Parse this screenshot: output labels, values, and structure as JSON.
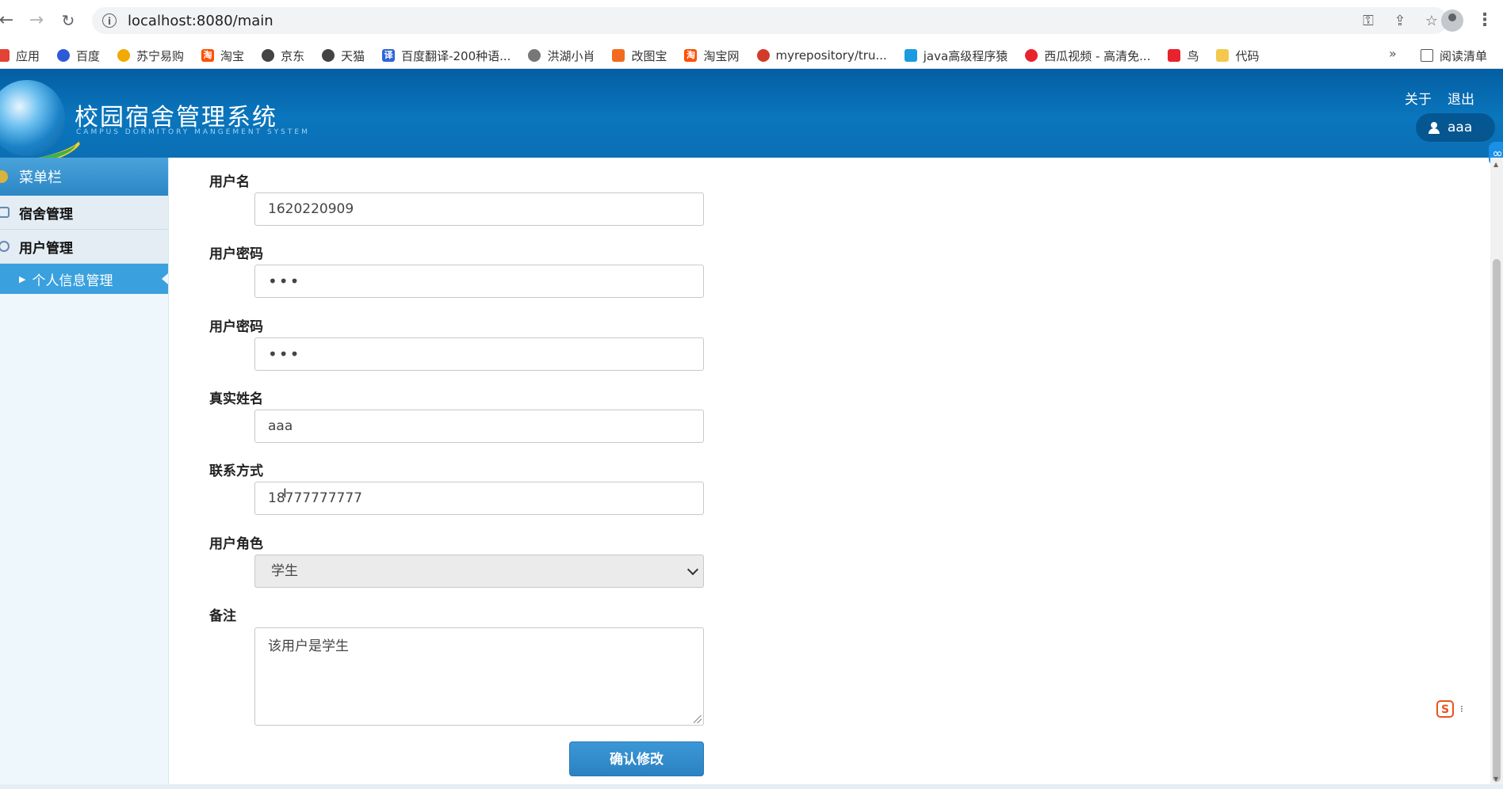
{
  "browser": {
    "url": "localhost:8080/main",
    "bookmarks": [
      {
        "label": "应用",
        "color": "#e34234"
      },
      {
        "label": "百度",
        "color": "#2d5bd8"
      },
      {
        "label": "苏宁易购",
        "color": "#f2a900"
      },
      {
        "label": "淘宝",
        "color": "#ff5000"
      },
      {
        "label": "京东",
        "color": "#444444"
      },
      {
        "label": "天猫",
        "color": "#444444"
      },
      {
        "label": "百度翻译-200种语...",
        "color": "#2d66d8"
      },
      {
        "label": "洪湖小肖",
        "color": "#777777"
      },
      {
        "label": "改图宝",
        "color": "#f26b1d"
      },
      {
        "label": "淘宝网",
        "color": "#ff5000"
      },
      {
        "label": "myrepository/tru...",
        "color": "#d23b2a"
      },
      {
        "label": "java高级程序猿",
        "color": "#1a9be0"
      },
      {
        "label": "西瓜视频 - 高清免...",
        "color": "#e8232d"
      },
      {
        "label": "鸟",
        "color": "#e8232d"
      },
      {
        "label": "代码",
        "color": "#f2c94c"
      }
    ],
    "more_label": "»",
    "reading_list": "阅读清单"
  },
  "header": {
    "title": "校园宿舍管理系统",
    "subtitle": "CAMPUS DORMITORY MANGEMENT SYSTEM",
    "about": "关于",
    "logout": "退出",
    "username": "aaa"
  },
  "sidebar": {
    "title": "菜单栏",
    "items": [
      {
        "label": "宿舍管理"
      },
      {
        "label": "用户管理"
      }
    ],
    "active_sub": "个人信息管理"
  },
  "form": {
    "username_label": "用户名",
    "username_value": "1620220909",
    "password_label": "用户密码",
    "password_value": "•••",
    "password2_label": "用户密码",
    "password2_value": "•••",
    "realname_label": "真实姓名",
    "realname_value": "aaa",
    "contact_label": "联系方式",
    "contact_value": "18777777777",
    "role_label": "用户角色",
    "role_value": "学生",
    "remark_label": "备注",
    "remark_value": "该用户是学生",
    "submit_label": "确认修改"
  }
}
